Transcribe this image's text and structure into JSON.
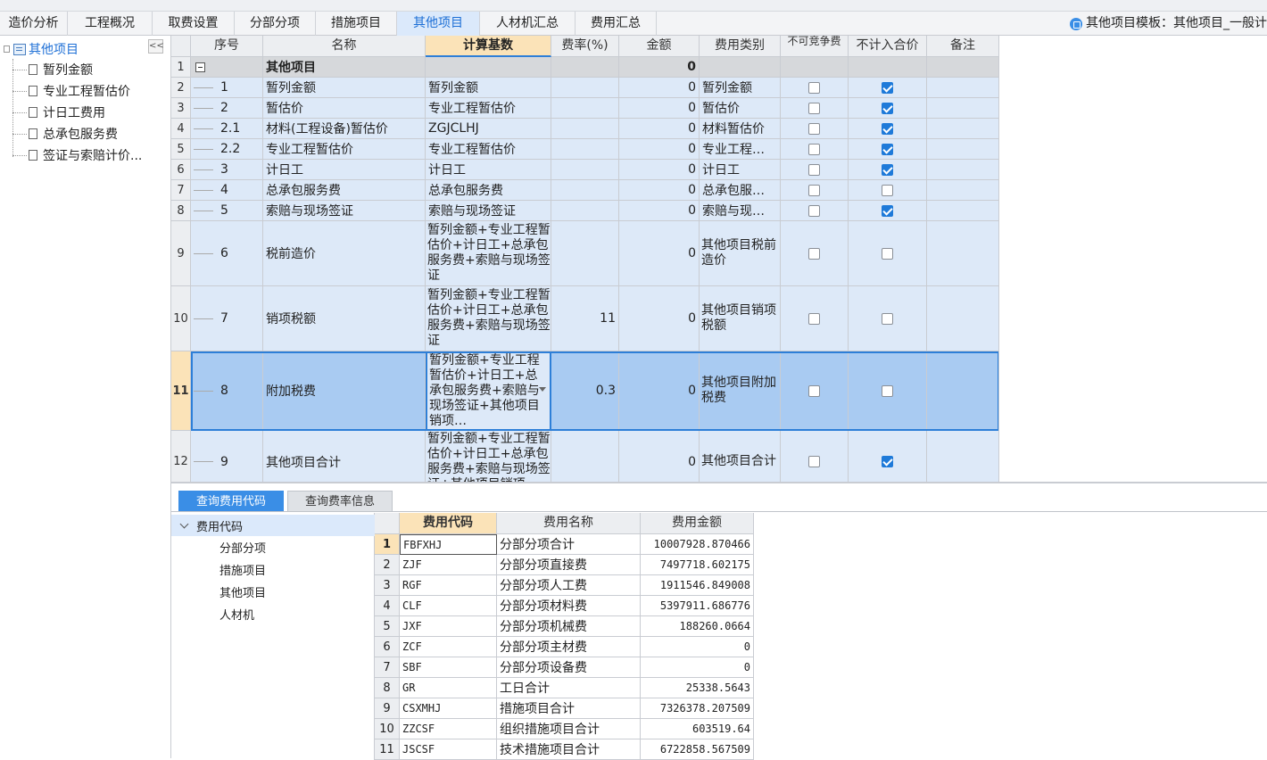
{
  "tabs": [
    {
      "label": "造价分析",
      "active": false
    },
    {
      "label": "工程概况",
      "active": false
    },
    {
      "label": "取费设置",
      "active": false
    },
    {
      "label": "分部分项",
      "active": false
    },
    {
      "label": "措施项目",
      "active": false
    },
    {
      "label": "其他项目",
      "active": true
    },
    {
      "label": "人材机汇总",
      "active": false
    },
    {
      "label": "费用汇总",
      "active": false
    }
  ],
  "template_info": "其他项目模板：其他项目_一般计",
  "sidebar": {
    "root": "其他项目",
    "collapse": "<<",
    "items": [
      "暂列金额",
      "专业工程暂估价",
      "计日工费用",
      "总承包服务费",
      "签证与索赔计价..."
    ]
  },
  "grid": {
    "headers": [
      "序号",
      "名称",
      "计算基数",
      "费率(%)",
      "金额",
      "费用类别",
      "不可竞争费",
      "不计入合价",
      "备注"
    ],
    "rows": [
      {
        "n": "1",
        "seq": "",
        "name": "其他项目",
        "base": "",
        "rate": "",
        "amount": "0",
        "cat": "",
        "nc": false,
        "nt": false
      },
      {
        "n": "2",
        "seq": "1",
        "name": "暂列金额",
        "base": "暂列金额",
        "rate": "",
        "amount": "0",
        "cat": "暂列金额",
        "nc": false,
        "nt": true
      },
      {
        "n": "3",
        "seq": "2",
        "name": "暂估价",
        "base": "专业工程暂估价",
        "rate": "",
        "amount": "0",
        "cat": "暂估价",
        "nc": false,
        "nt": true
      },
      {
        "n": "4",
        "seq": "2.1",
        "name": "材料(工程设备)暂估价",
        "base": "ZGJCLHJ",
        "rate": "",
        "amount": "0",
        "cat": "材料暂估价",
        "nc": false,
        "nt": true
      },
      {
        "n": "5",
        "seq": "2.2",
        "name": "专业工程暂估价",
        "base": "专业工程暂估价",
        "rate": "",
        "amount": "0",
        "cat": "专业工程…",
        "nc": false,
        "nt": true
      },
      {
        "n": "6",
        "seq": "3",
        "name": "计日工",
        "base": "计日工",
        "rate": "",
        "amount": "0",
        "cat": "计日工",
        "nc": false,
        "nt": true
      },
      {
        "n": "7",
        "seq": "4",
        "name": "总承包服务费",
        "base": "总承包服务费",
        "rate": "",
        "amount": "0",
        "cat": "总承包服…",
        "nc": false,
        "nt": false
      },
      {
        "n": "8",
        "seq": "5",
        "name": "索赔与现场签证",
        "base": "索赔与现场签证",
        "rate": "",
        "amount": "0",
        "cat": "索赔与现…",
        "nc": false,
        "nt": true
      },
      {
        "n": "9",
        "seq": "6",
        "name": "税前造价",
        "base": "暂列金额+专业工程暂估价+计日工+总承包服务费+索赔与现场签证",
        "rate": "",
        "amount": "0",
        "cat": "其他项目税前造价",
        "nc": false,
        "nt": false
      },
      {
        "n": "10",
        "seq": "7",
        "name": "销项税额",
        "base": "暂列金额+专业工程暂估价+计日工+总承包服务费+索赔与现场签证",
        "rate": "11",
        "amount": "0",
        "cat": "其他项目销项税额",
        "nc": false,
        "nt": false
      },
      {
        "n": "11",
        "seq": "8",
        "name": "附加税费",
        "base": "暂列金额+专业工程暂估价+计日工+总承包服务费+索赔与现场签证+其他项目销项…",
        "rate": "0.3",
        "amount": "0",
        "cat": "其他项目附加税费",
        "nc": false,
        "nt": false
      },
      {
        "n": "12",
        "seq": "9",
        "name": "其他项目合计",
        "base": "暂列金额+专业工程暂估价+计日工+总承包服务费+索赔与现场签证+其他项目销项…",
        "rate": "",
        "amount": "0",
        "cat": "其他项目合计",
        "nc": false,
        "nt": true
      }
    ]
  },
  "bottom": {
    "tabs": [
      "查询费用代码",
      "查询费率信息"
    ],
    "tree_root": "费用代码",
    "tree_items": [
      "分部分项",
      "措施项目",
      "其他项目",
      "人材机"
    ],
    "table_headers": [
      "费用代码",
      "费用名称",
      "费用金额"
    ],
    "table_rows": [
      {
        "n": "1",
        "code": "FBFXHJ",
        "name": "分部分项合计",
        "amount": "10007928.870466"
      },
      {
        "n": "2",
        "code": "ZJF",
        "name": "分部分项直接费",
        "amount": "7497718.602175"
      },
      {
        "n": "3",
        "code": "RGF",
        "name": "分部分项人工费",
        "amount": "1911546.849008"
      },
      {
        "n": "4",
        "code": "CLF",
        "name": "分部分项材料费",
        "amount": "5397911.686776"
      },
      {
        "n": "5",
        "code": "JXF",
        "name": "分部分项机械费",
        "amount": "188260.0664"
      },
      {
        "n": "6",
        "code": "ZCF",
        "name": "分部分项主材费",
        "amount": "0"
      },
      {
        "n": "7",
        "code": "SBF",
        "name": "分部分项设备费",
        "amount": "0"
      },
      {
        "n": "8",
        "code": "GR",
        "name": "工日合计",
        "amount": "25338.5643"
      },
      {
        "n": "9",
        "code": "CSXMHJ",
        "name": "措施项目合计",
        "amount": "7326378.207509"
      },
      {
        "n": "10",
        "code": "ZZCSF",
        "name": "组织措施项目合计",
        "amount": "603519.64"
      },
      {
        "n": "11",
        "code": "JSCSF",
        "name": "技术措施项目合计",
        "amount": "6722858.567509"
      }
    ]
  }
}
